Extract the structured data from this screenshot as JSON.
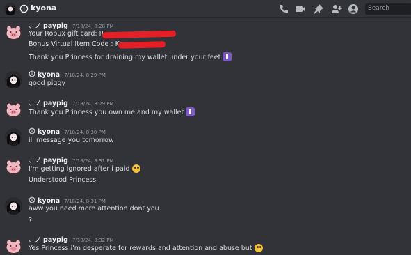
{
  "header": {
    "channel_name": "kyona",
    "search_placeholder": "Search",
    "icons": [
      "phone-icon",
      "video-icon",
      "pin-icon",
      "add-friend-icon",
      "profile-icon"
    ]
  },
  "messages": [
    {
      "author": "paypig",
      "author_prefix": "、ノ",
      "timestamp": "7/18/24, 8:28 PM",
      "lines": [
        "Your Robux gift card: R",
        "Bonus Virtual Item Code : K",
        "Thank you Princess for draining my wallet under your feet"
      ]
    },
    {
      "author": "kyona",
      "timestamp": "7/18/24, 8:29 PM",
      "lines": [
        "good piggy"
      ]
    },
    {
      "author": "paypig",
      "author_prefix": "、ノ",
      "timestamp": "7/18/24, 8:29 PM",
      "lines": [
        "Thank you Princess you own me and my wallet"
      ]
    },
    {
      "author": "kyona",
      "timestamp": "7/18/24, 8:30 PM",
      "lines": [
        "ill message you tomorrow"
      ]
    },
    {
      "author": "paypig",
      "author_prefix": "、ノ",
      "timestamp": "7/18/24, 8:31 PM",
      "lines": [
        "I'm getting ignored after i paid",
        "Understood Princess"
      ]
    },
    {
      "author": "kyona",
      "timestamp": "7/18/24, 8:31 PM",
      "lines": [
        "aww you need more attention dont you",
        "?"
      ]
    },
    {
      "author": "paypig",
      "author_prefix": "、ノ",
      "timestamp": "7/18/24, 8:32 PM",
      "lines": [
        "Yes Princess i'm desperate for rewards and attention and abuse but"
      ]
    }
  ],
  "colors": {
    "background": "#313338",
    "redaction": "#e41f25",
    "timestamp": "#949ba4"
  }
}
